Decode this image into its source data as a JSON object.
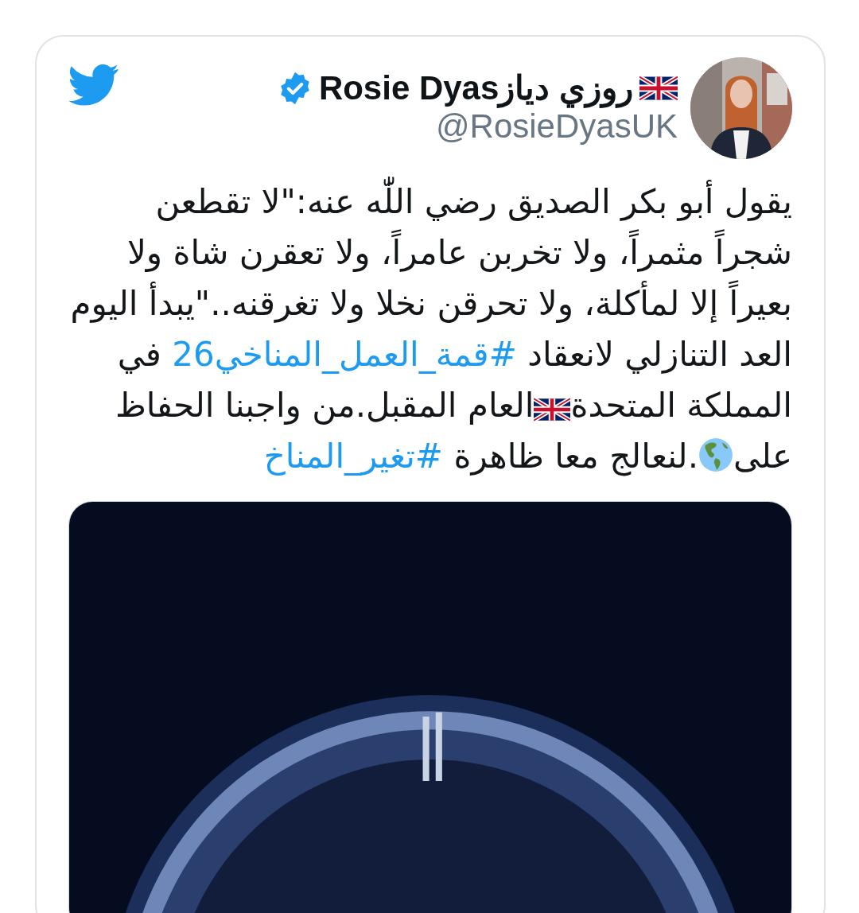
{
  "author": {
    "display_name": "Rosie Dyasروزي دياز",
    "name_flag": {
      "kind": "flag"
    },
    "verified": true,
    "handle": "@RosieDyasUK"
  },
  "tweet": {
    "segments": [
      {
        "kind": "text",
        "text": "يقول أبو بكر الصديق رضي اللّٰه عنه:\"لا تقطعن شجراً مثمراً، ولا تخربن عامراً، ولا تعقرن شاة ولا بعيراً إلا لمأكلة، ولا تحرقن نخلا ولا تغرقنه..\"يبدأ اليوم العد التنازلي لانعقاد "
      },
      {
        "kind": "hashtag",
        "text": "#قمة_العمل_المناخي26"
      },
      {
        "kind": "text",
        "text": " في المملكة المتحدة"
      },
      {
        "kind": "flag"
      },
      {
        "kind": "text",
        "text": "العام المقبل.من واجبنا الحفاظ على"
      },
      {
        "kind": "globe"
      },
      {
        "kind": "text",
        "text": ".لنعالج معا ظاهرة "
      },
      {
        "kind": "hashtag",
        "text": "#تغير_المناخ"
      }
    ]
  }
}
